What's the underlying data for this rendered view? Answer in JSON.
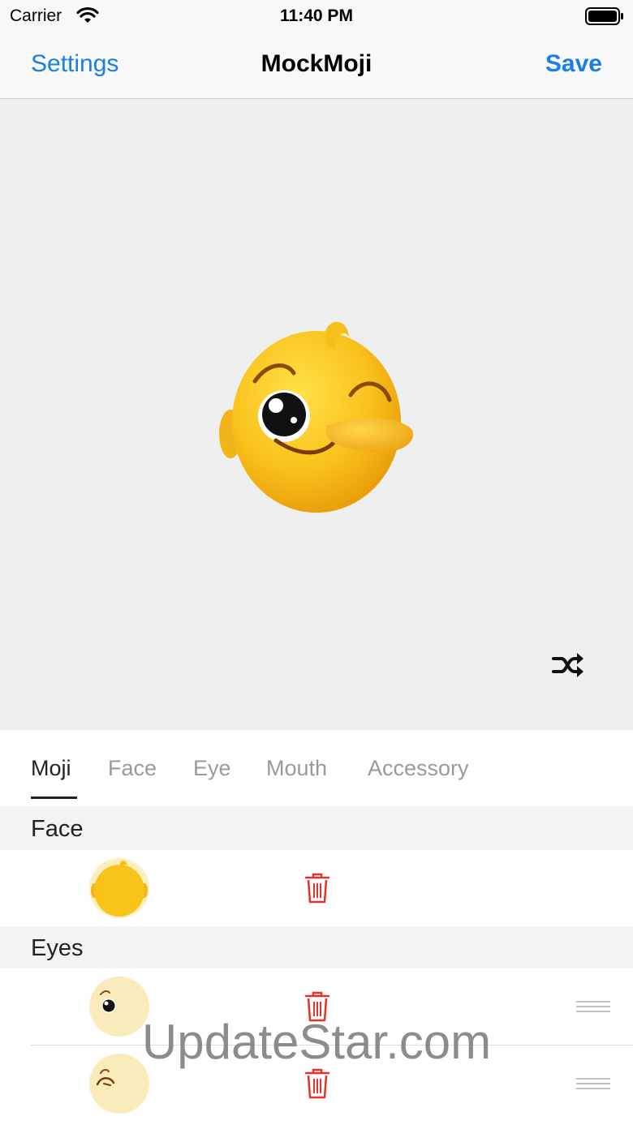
{
  "status_bar": {
    "carrier": "Carrier",
    "time": "11:40 PM"
  },
  "nav": {
    "left_label": "Settings",
    "title": "MockMoji",
    "right_label": "Save"
  },
  "canvas": {
    "background": "#efefef",
    "shuffle_icon": "shuffle-icon"
  },
  "tabs": [
    {
      "label": "Moji",
      "active": true
    },
    {
      "label": "Face",
      "active": false
    },
    {
      "label": "Eye",
      "active": false
    },
    {
      "label": "Mouth",
      "active": false
    },
    {
      "label": "Accessory",
      "active": false
    }
  ],
  "sections": [
    {
      "title": "Face",
      "items": [
        {
          "thumb": "face-thumbnail",
          "delete_icon": "trash-icon"
        }
      ]
    },
    {
      "title": "Eyes",
      "items": [
        {
          "thumb": "eye-open-thumbnail",
          "delete_icon": "trash-icon",
          "reorder_icon": "reorder-icon"
        },
        {
          "thumb": "eye-wink-thumbnail",
          "delete_icon": "trash-icon",
          "reorder_icon": "reorder-icon"
        }
      ]
    }
  ],
  "watermark": "UpdateStar.com",
  "colors": {
    "accent": "#1a7fe6",
    "delete": "#e5332a",
    "face_yellow": "#f6b712"
  }
}
